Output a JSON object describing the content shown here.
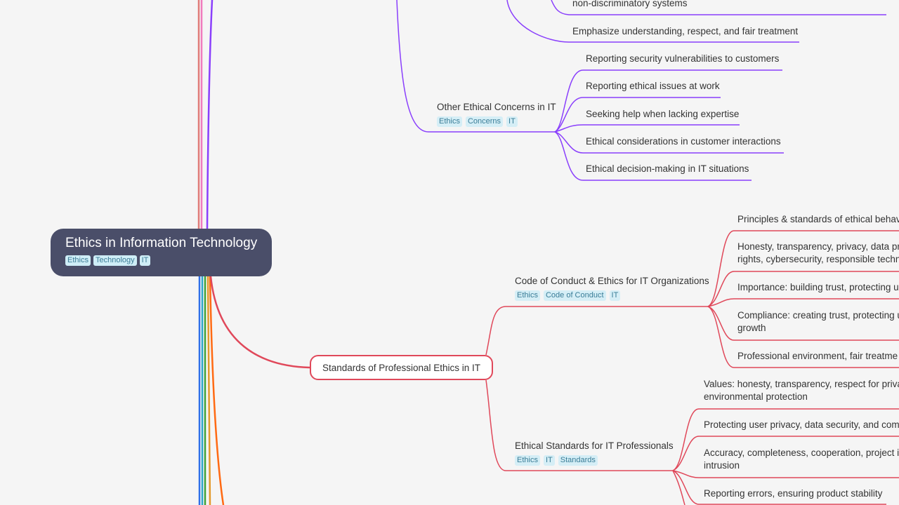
{
  "root": {
    "title": "Ethics in Information Technology",
    "tags": [
      "Ethics",
      "Technology",
      "IT"
    ]
  },
  "colors": {
    "root_bg": "#4a4e69",
    "purple_branch": "#8a3ffc",
    "red_branch": "#e0485a",
    "tag_bg": "#d5eef6",
    "tag_text": "#3a7d97",
    "background": "#f5f5f5"
  },
  "purple_branch": {
    "leaves_top": [
      "non-discriminatory systems",
      "Emphasize understanding, respect, and fair treatment"
    ],
    "other_concerns": {
      "title": "Other Ethical Concerns in IT",
      "tags": [
        "Ethics",
        "Concerns",
        "IT"
      ],
      "leaves": [
        "Reporting security vulnerabilities to customers",
        "Reporting ethical issues at work",
        "Seeking help when lacking expertise",
        "Ethical considerations in customer interactions",
        "Ethical decision-making in IT situations"
      ]
    }
  },
  "red_branch": {
    "title": "Standards of Professional Ethics in IT",
    "code_of_conduct": {
      "title": "Code of Conduct & Ethics for IT Organizations",
      "tags": [
        "Ethics",
        "Code of Conduct",
        "IT"
      ],
      "leaves": [
        "Principles & standards of ethical behav",
        "Honesty, transparency, privacy, data pr",
        "rights, cybersecurity, responsible techn",
        "Importance: building trust, protecting u",
        "Compliance: creating trust, protecting u",
        "growth",
        "Professional environment, fair treatme"
      ]
    },
    "ethical_standards": {
      "title": "Ethical Standards for IT Professionals",
      "tags": [
        "Ethics",
        "IT",
        "Standards"
      ],
      "leaves": [
        "Values: honesty, transparency, respect for priva",
        "environmental protection",
        "Protecting user privacy, data security, and com",
        "Accuracy, completeness, cooperation, project i",
        "intrusion",
        "Reporting errors, ensuring product stability"
      ]
    }
  }
}
